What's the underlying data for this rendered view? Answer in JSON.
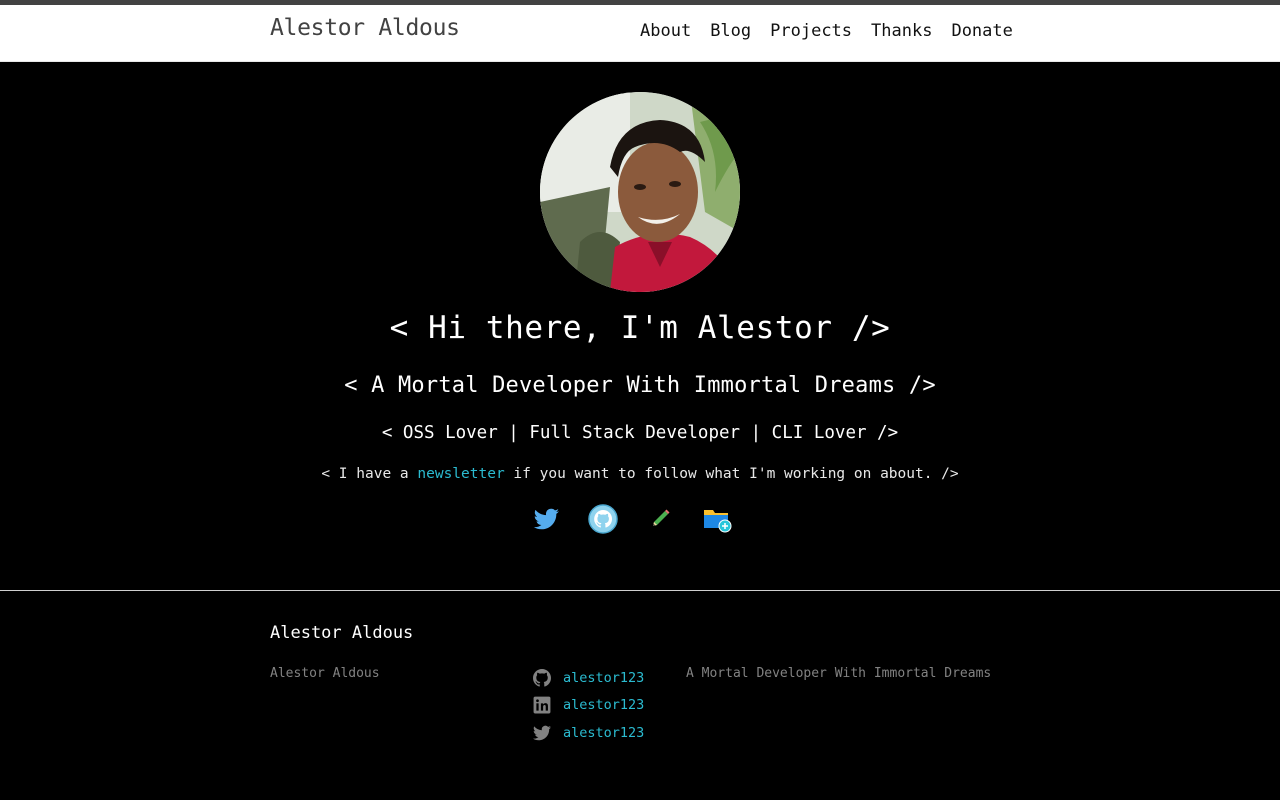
{
  "header": {
    "title": "Alestor Aldous",
    "nav": [
      "About",
      "Blog",
      "Projects",
      "Thanks",
      "Donate"
    ]
  },
  "hero": {
    "headline": "< Hi there, I'm Alestor />",
    "tagline": "< A Mortal Developer With Immortal Dreams />",
    "roles": "< OSS Lover | Full Stack Developer | CLI Lover />",
    "newsletter_prefix": "< I have a ",
    "newsletter_link": "newsletter",
    "newsletter_suffix": " if you want to follow what I'm working on about. />",
    "social_icons": [
      "twitter-icon",
      "github-icon",
      "pencil-icon",
      "folder-icon"
    ]
  },
  "footer": {
    "heading": "Alestor Aldous",
    "name": "Alestor Aldous",
    "links": [
      {
        "icon": "github-icon",
        "label": "alestor123"
      },
      {
        "icon": "linkedin-icon",
        "label": "alestor123"
      },
      {
        "icon": "twitter-icon",
        "label": "alestor123"
      }
    ],
    "description": "A Mortal Developer With Immortal Dreams"
  },
  "colors": {
    "link_accent": "#2bbbd0",
    "muted_text": "#828282",
    "header_bg": "#ffffff",
    "page_bg": "#000000"
  }
}
